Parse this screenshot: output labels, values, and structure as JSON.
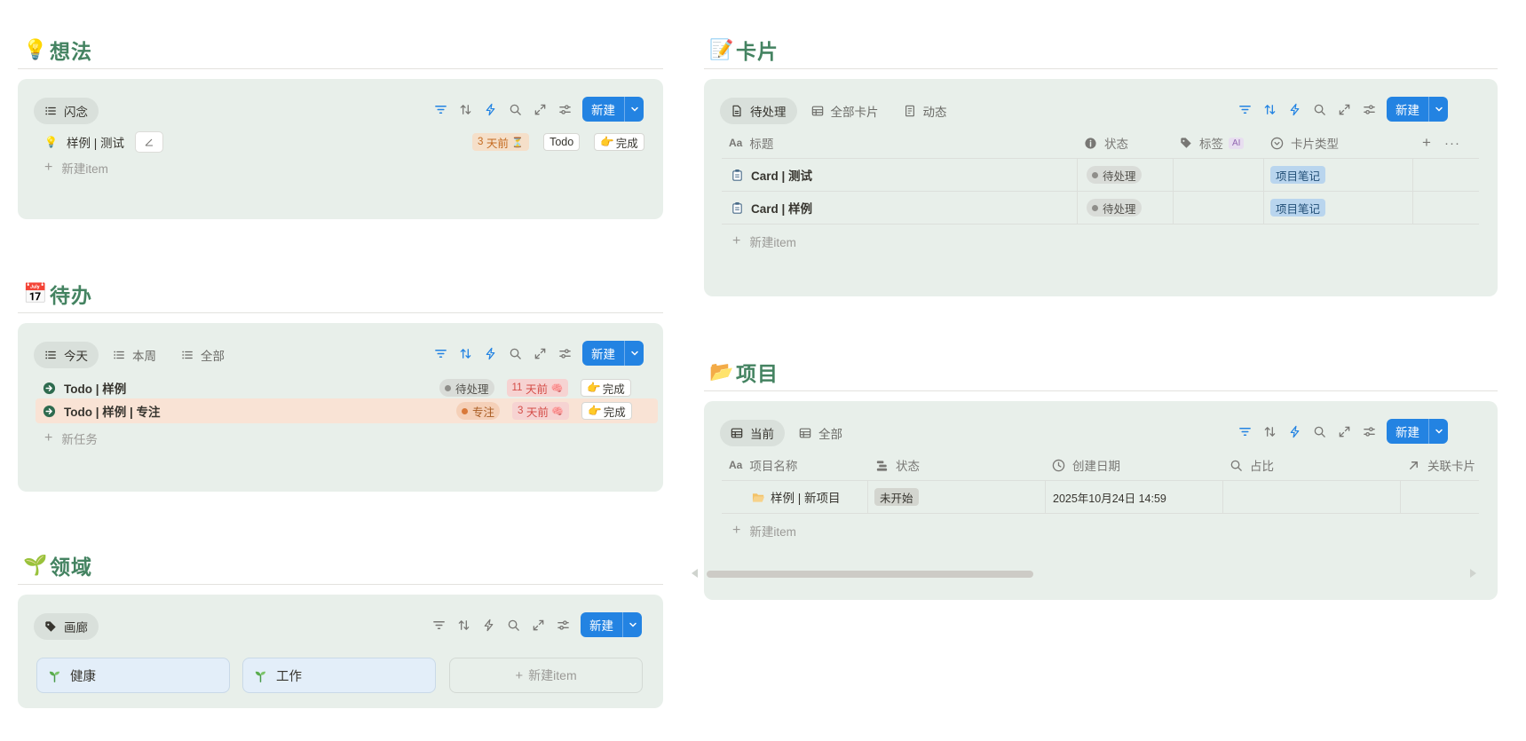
{
  "ideas": {
    "emoji": "💡",
    "title": "想法",
    "tab": "闪念",
    "new_label": "新建",
    "row": {
      "title": "样例 | 测试",
      "days": "3",
      "days_suffix": "天前",
      "status": "Todo",
      "done": "完成"
    },
    "add_label": "新建item"
  },
  "todo": {
    "emoji": "📅",
    "title": "待办",
    "tabs": [
      "今天",
      "本周",
      "全部"
    ],
    "new_label": "新建",
    "rows": [
      {
        "title": "Todo | 样例",
        "status": "待处理",
        "days": "11",
        "days_suffix": "天前",
        "done": "完成"
      },
      {
        "title": "Todo | 样例 | 专注",
        "status": "专注",
        "days": "3",
        "days_suffix": "天前",
        "done": "完成"
      }
    ],
    "add_label": "新任务"
  },
  "areas": {
    "emoji": "🌱",
    "title": "领域",
    "tab": "画廊",
    "new_label": "新建",
    "cards": [
      "健康",
      "工作"
    ],
    "add_label": "新建item"
  },
  "cards": {
    "emoji": "📝",
    "title": "卡片",
    "tabs": [
      "待处理",
      "全部卡片",
      "动态"
    ],
    "new_label": "新建",
    "columns": {
      "title": "标题",
      "status": "状态",
      "tags": "标签",
      "ai_badge": "AI",
      "type": "卡片类型"
    },
    "rows": [
      {
        "title": "Card | 测试",
        "status": "待处理",
        "type": "项目笔记"
      },
      {
        "title": "Card | 样例",
        "status": "待处理",
        "type": "项目笔记"
      }
    ],
    "add_label": "新建item"
  },
  "projects": {
    "emoji": "📂",
    "title": "项目",
    "tabs": [
      "当前",
      "全部"
    ],
    "new_label": "新建",
    "columns": {
      "name": "项目名称",
      "status": "状态",
      "created": "创建日期",
      "ratio": "占比",
      "linked": "关联卡片"
    },
    "rows": [
      {
        "name": "样例 | 新项目",
        "status": "未开始",
        "created": "2025年10月24日 14:59"
      }
    ],
    "add_label": "新建item"
  },
  "colors": {
    "accent": "#2383e2",
    "heading": "#448361",
    "panel": "#e8efea"
  }
}
